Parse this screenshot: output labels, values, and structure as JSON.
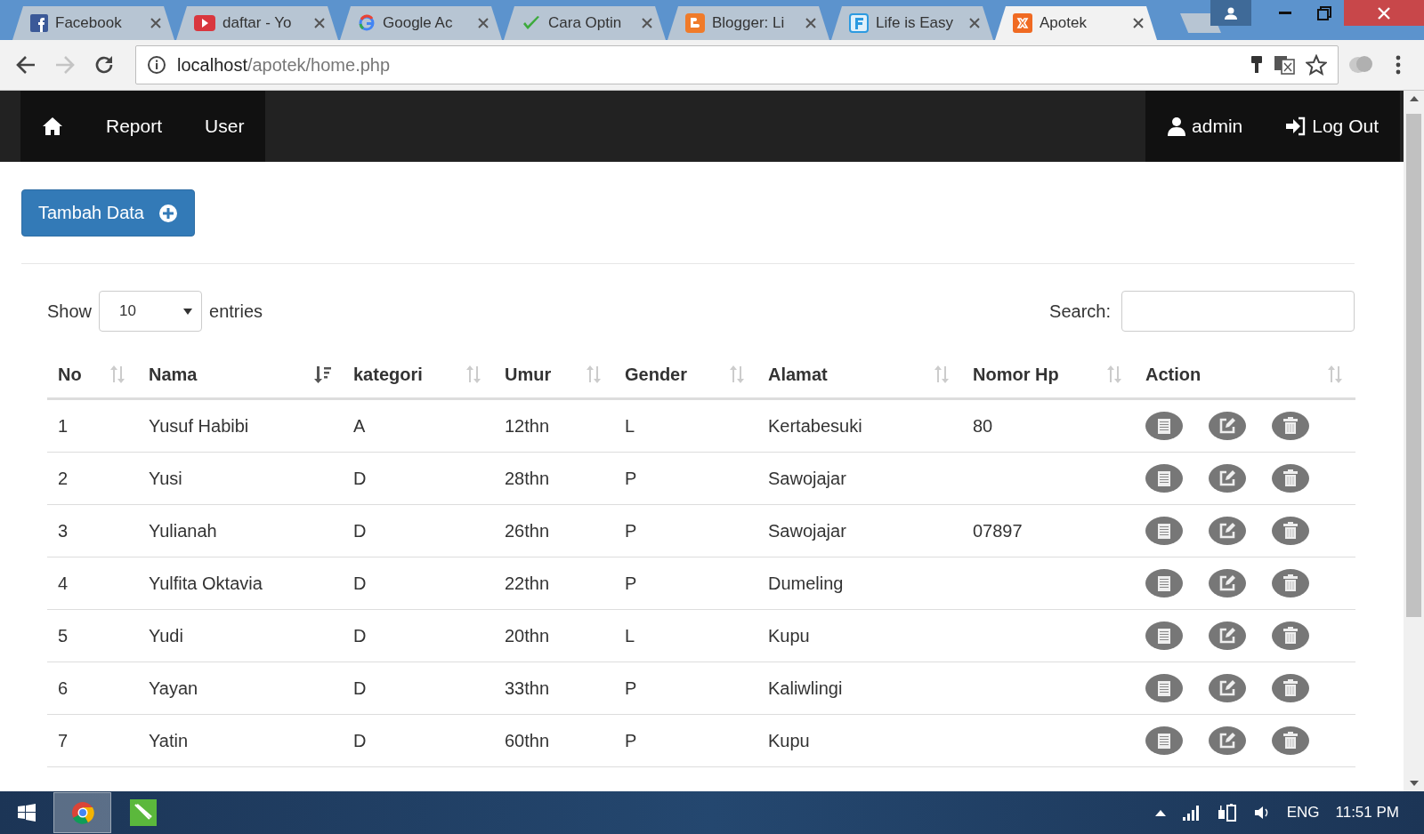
{
  "browser": {
    "tabs": [
      {
        "kind": "fb",
        "title": "Facebook",
        "selected": false
      },
      {
        "kind": "video",
        "title": "daftar - Yo",
        "selected": false
      },
      {
        "kind": "g",
        "title": "Google Ac",
        "selected": false
      },
      {
        "kind": "check",
        "title": "Cara Optin",
        "selected": false
      },
      {
        "kind": "blog",
        "title": "Blogger: Li",
        "selected": false
      },
      {
        "kind": "f",
        "title": "Life is Easy",
        "selected": false
      },
      {
        "kind": "xampp",
        "title": "Apotek",
        "selected": true
      }
    ],
    "url": {
      "host": "localhost",
      "path": "/apotek/home.php"
    }
  },
  "navbar": {
    "items": [
      "Report",
      "User"
    ],
    "user": "admin",
    "logout": "Log Out"
  },
  "add_button": "Tambah Data",
  "length": {
    "before": "Show",
    "value": "10",
    "after": "entries"
  },
  "search": {
    "label": "Search:"
  },
  "table": {
    "columns": [
      {
        "label": "No",
        "sorted": false
      },
      {
        "label": "Nama",
        "sorted": true
      },
      {
        "label": "kategori",
        "sorted": false
      },
      {
        "label": "Umur",
        "sorted": false
      },
      {
        "label": "Gender",
        "sorted": false
      },
      {
        "label": "Alamat",
        "sorted": false
      },
      {
        "label": "Nomor Hp",
        "sorted": false
      },
      {
        "label": "Action",
        "sorted": false
      }
    ],
    "rows": [
      {
        "no": "1",
        "nama": "Yusuf Habibi",
        "kategori": "A",
        "umur": "12thn",
        "gender": "L",
        "alamat": "Kertabesuki",
        "nomor_hp": "80"
      },
      {
        "no": "2",
        "nama": "Yusi",
        "kategori": "D",
        "umur": "28thn",
        "gender": "P",
        "alamat": "Sawojajar"
      },
      {
        "no": "3",
        "nama": "Yulianah",
        "kategori": "D",
        "umur": "26thn",
        "gender": "P",
        "alamat": "Sawojajar",
        "nomor_hp": "07897"
      },
      {
        "no": "4",
        "nama": "Yulfita Oktavia",
        "kategori": "D",
        "umur": "22thn",
        "gender": "P",
        "alamat": "Dumeling"
      },
      {
        "no": "5",
        "nama": "Yudi",
        "kategori": "D",
        "umur": "20thn",
        "gender": "L",
        "alamat": "Kupu"
      },
      {
        "no": "6",
        "nama": "Yayan",
        "kategori": "D",
        "umur": "33thn",
        "gender": "P",
        "alamat": "Kaliwlingi"
      },
      {
        "no": "7",
        "nama": "Yatin",
        "kategori": "D",
        "umur": "60thn",
        "gender": "P",
        "alamat": "Kupu"
      }
    ]
  },
  "taskbar": {
    "apps": [
      {
        "kind": "browser",
        "selected": true
      },
      {
        "kind": "editor",
        "selected": false
      }
    ],
    "language": "ENG",
    "time": "11:51 PM"
  }
}
